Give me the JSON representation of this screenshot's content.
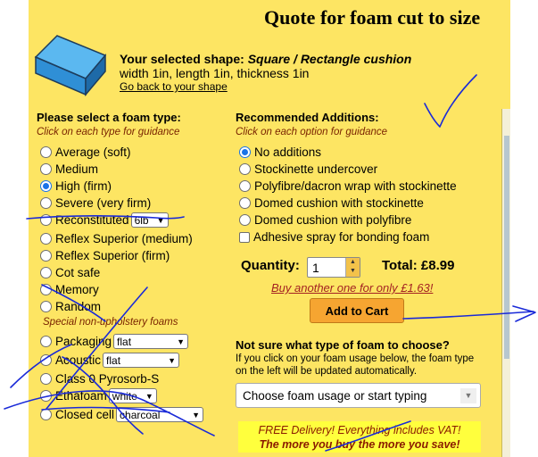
{
  "header": {
    "title": "Quote for foam cut to size"
  },
  "selection": {
    "label": "Your selected shape:",
    "shape": "Square / Rectangle cushion",
    "dimensions": "width 1in, length 1in, thickness 1in",
    "back_link": "Go back to your shape"
  },
  "foam_types": {
    "heading": "Please select a foam type:",
    "note": "Click on each type for guidance",
    "options": [
      {
        "label": "Average (soft)",
        "selected": false
      },
      {
        "label": "Medium",
        "selected": false
      },
      {
        "label": "High (firm)",
        "selected": true
      },
      {
        "label": "Severe (very firm)",
        "selected": false
      },
      {
        "label": "Reconstituted",
        "selected": false,
        "select_value": "6lb"
      },
      {
        "label": "Reflex Superior (medium)",
        "selected": false
      },
      {
        "label": "Reflex Superior (firm)",
        "selected": false
      },
      {
        "label": "Cot safe",
        "selected": false
      },
      {
        "label": "Memory",
        "selected": false
      },
      {
        "label": "Random",
        "selected": false
      }
    ],
    "special_note": "Special non-upholstery foams",
    "special_options": [
      {
        "label": "Packaging",
        "selected": false,
        "select_value": "flat"
      },
      {
        "label": "Acoustic",
        "selected": false,
        "select_value": "flat"
      },
      {
        "label": "Class 0 Pyrosorb-S",
        "selected": false
      },
      {
        "label": "Ethafoam",
        "selected": false,
        "select_value": "white"
      },
      {
        "label": "Closed cell",
        "selected": false,
        "select_value": "charcoal"
      }
    ]
  },
  "additions": {
    "heading": "Recommended Additions:",
    "note": "Click on each option for guidance",
    "options": [
      {
        "label": "No additions",
        "selected": true
      },
      {
        "label": "Stockinette undercover",
        "selected": false
      },
      {
        "label": "Polyfibre/dacron wrap with stockinette",
        "selected": false
      },
      {
        "label": "Domed cushion with stockinette",
        "selected": false
      },
      {
        "label": "Domed cushion with polyfibre",
        "selected": false
      }
    ],
    "checkbox_label": "Adhesive spray for bonding foam",
    "checkbox_checked": false
  },
  "order": {
    "quantity_label": "Quantity:",
    "quantity_value": "1",
    "total_label": "Total: £8.99",
    "buy_another": "Buy another one for only £1.63!",
    "cart_button": "Add to Cart"
  },
  "guide": {
    "heading": "Not sure what type of foam to choose?",
    "text": "If you click on your foam usage below, the foam type on the left will be updated automatically.",
    "select_placeholder": "Choose foam usage or start typing"
  },
  "promo": {
    "line1": "FREE Delivery!  Everything includes VAT!",
    "line2": "The more you buy the more you save!"
  },
  "colors": {
    "panel": "#fde563",
    "ink": "#1a2ad8",
    "radio_selected": "#1a73e8",
    "cart_button": "#f6a531",
    "promo_bg": "#ffff3d"
  }
}
